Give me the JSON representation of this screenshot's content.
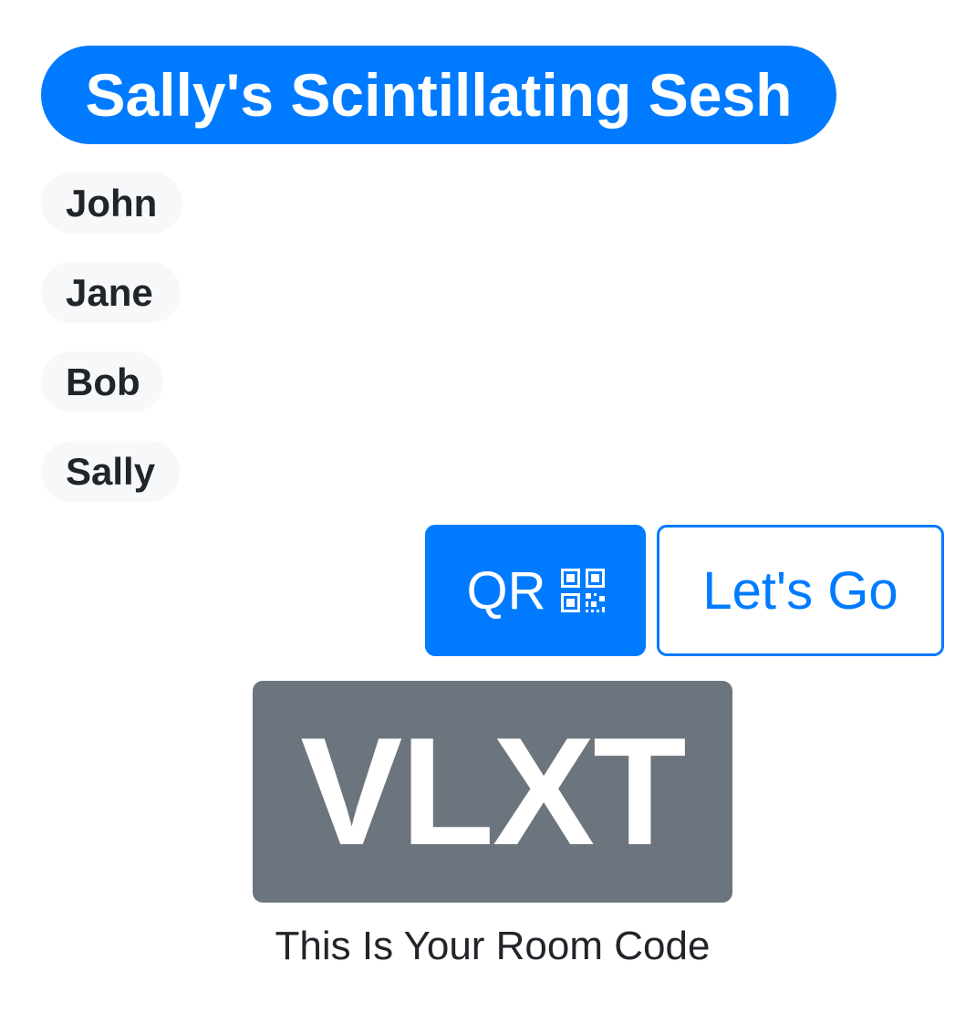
{
  "session": {
    "title": "Sally's Scintillating Sesh"
  },
  "players": [
    {
      "name": "John"
    },
    {
      "name": "Jane"
    },
    {
      "name": "Bob"
    },
    {
      "name": "Sally"
    }
  ],
  "actions": {
    "qr_label": "QR",
    "qr_icon": "qr-code-icon",
    "go_label": "Let's Go"
  },
  "room": {
    "code": "VLXT",
    "caption": "This Is Your Room Code"
  },
  "colors": {
    "primary": "#007bff",
    "secondary": "#6c757d",
    "pill_background": "#f7f8f9",
    "text": "#212529"
  }
}
